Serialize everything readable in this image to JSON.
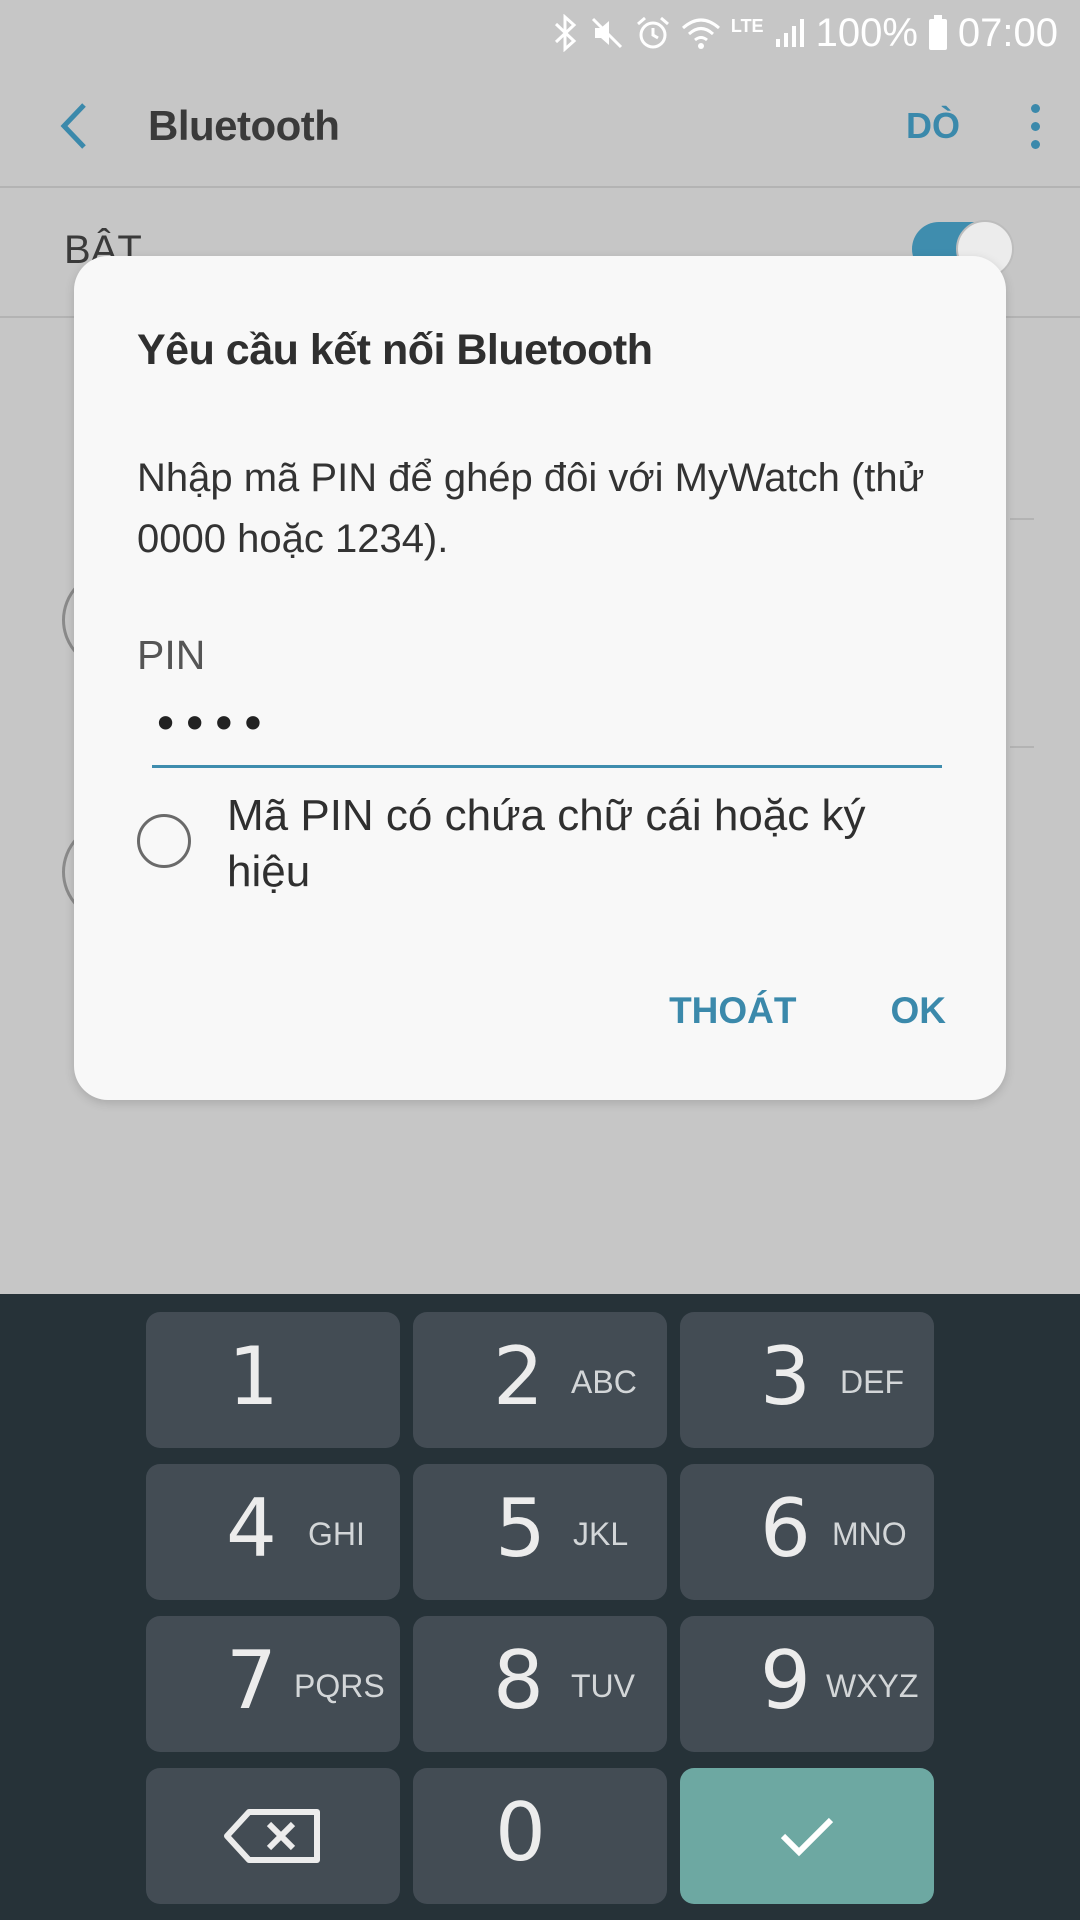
{
  "status_bar": {
    "battery": "100%",
    "time": "07:00",
    "network": "LTE",
    "icons": [
      "bluetooth-icon",
      "mute-icon",
      "alarm-icon",
      "wifi-icon",
      "signal-icon",
      "battery-icon"
    ]
  },
  "app_bar": {
    "title": "Bluetooth",
    "scan_label": "DÒ",
    "back_icon": "chevron-left-icon",
    "more_icon": "more-vert-icon"
  },
  "background": {
    "on_label": "BẬT",
    "toggle_on": true
  },
  "dialog": {
    "title": "Yêu cầu kết nối Bluetooth",
    "message": "Nhập mã PIN để ghép đôi với MyWatch (thử 0000 hoặc 1234).",
    "pin_label": "PIN",
    "pin_value": "••••",
    "checkbox_label": "Mã PIN có chứa chữ cái hoặc ký hiệu",
    "checkbox_checked": false,
    "cancel_label": "THOÁT",
    "ok_label": "OK"
  },
  "keypad": {
    "keys": [
      {
        "num": "1",
        "letters": ""
      },
      {
        "num": "2",
        "letters": "ABC"
      },
      {
        "num": "3",
        "letters": "DEF"
      },
      {
        "num": "4",
        "letters": "GHI"
      },
      {
        "num": "5",
        "letters": "JKL"
      },
      {
        "num": "6",
        "letters": "MNO"
      },
      {
        "num": "7",
        "letters": "PQRS"
      },
      {
        "num": "8",
        "letters": "TUV"
      },
      {
        "num": "9",
        "letters": "WXYZ"
      },
      {
        "num": "0",
        "letters": ""
      }
    ],
    "backspace_icon": "backspace-icon",
    "confirm_icon": "check-icon"
  },
  "colors": {
    "accent": "#3b89ab",
    "keypad_bg": "#263238",
    "key_bg": "#434c54",
    "confirm_bg": "#6da8a2"
  }
}
